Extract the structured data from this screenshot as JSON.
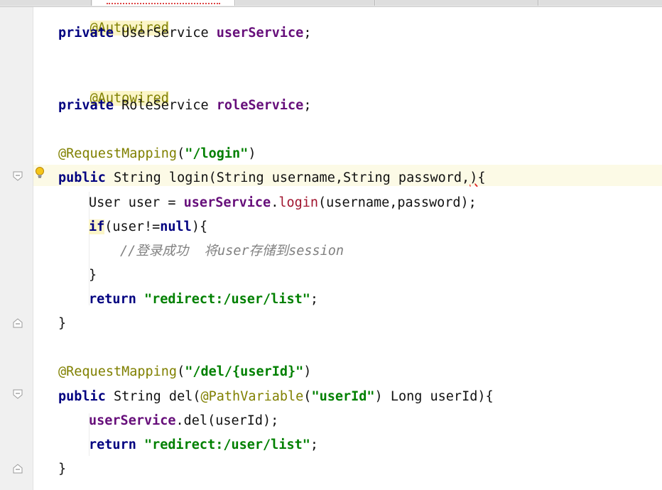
{
  "code": {
    "l1": {
      "annotation": "@Autowired"
    },
    "l2": {
      "kw": "private",
      "type": "UserService",
      "field": "userService",
      "end": ";"
    },
    "l3": {
      "annotation": "@Autowired"
    },
    "l4": {
      "kw": "private",
      "type": "RoleService",
      "field": "roleService",
      "end": ";"
    },
    "l5": {
      "annotation": "@RequestMapping",
      "open": "(",
      "path": "\"/login\"",
      "close": ")"
    },
    "l6": {
      "kw": "public",
      "sig": "String login(String username,String password,",
      "cursor": ")",
      "end": "{"
    },
    "l7": {
      "pre": "User user = ",
      "field": "userService",
      "dot": ".",
      "method": "login",
      "args": "(username,password);"
    },
    "l8": {
      "kw": "if",
      "cond": "(user!=",
      "null": "null",
      "end": "){"
    },
    "l9": {
      "comment": "//登录成功  将user存储到session"
    },
    "l10": {
      "brace": "}"
    },
    "l11": {
      "kw": "return",
      "str": "\"redirect:/user/list\"",
      "end": ";"
    },
    "l12": {
      "brace": "}"
    },
    "l13": {
      "annotation": "@RequestMapping",
      "open": "(",
      "path": "\"/del/{userId}\"",
      "close": ")"
    },
    "l14": {
      "kw": "public",
      "sig": "String del(",
      "annotation": "@PathVariable",
      "open": "(",
      "str": "\"userId\"",
      "rest": ") Long userId){"
    },
    "l15": {
      "field": "userService",
      "rest": ".del(userId);"
    },
    "l16": {
      "kw": "return",
      "str": "\"redirect:/user/list\"",
      "end": ";"
    },
    "l17": {
      "brace": "}"
    }
  },
  "colors": {
    "keyword": "#000080",
    "annotation": "#808000",
    "string": "#008000",
    "field": "#660e7a",
    "method": "#a0142e",
    "comment": "#808080",
    "current_line": "#fcfae6"
  },
  "icons": [
    "fold-marker-icon",
    "lightbulb-icon"
  ]
}
